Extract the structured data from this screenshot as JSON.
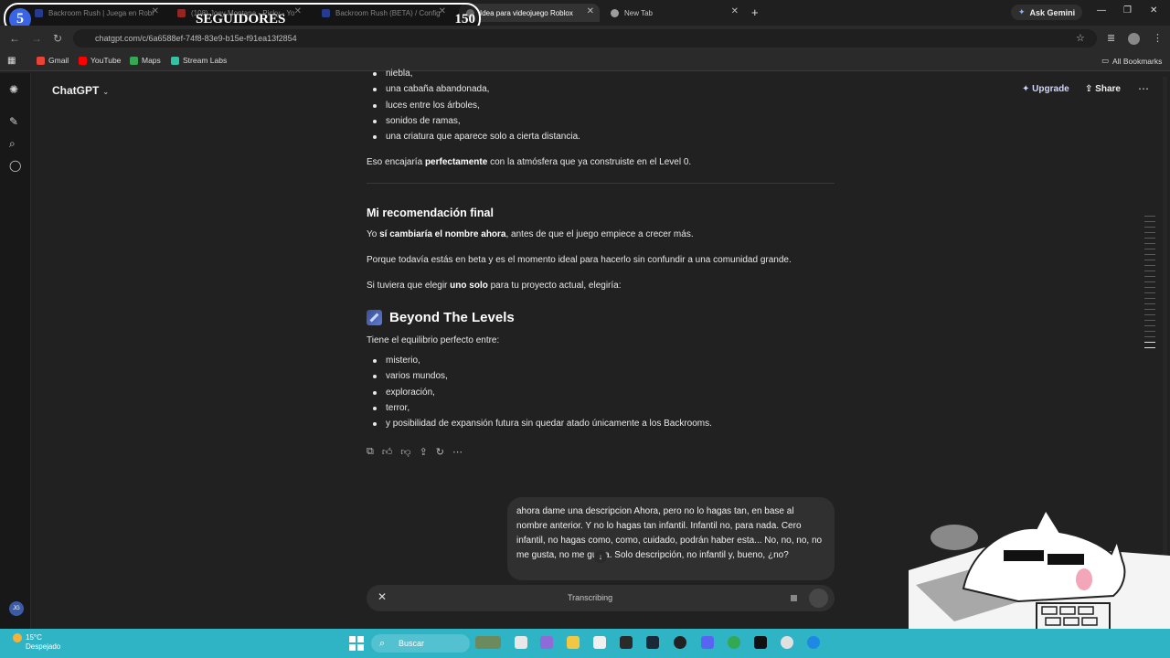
{
  "browser": {
    "tabs": [
      {
        "title": "Backroom Rush | Juega en Robl",
        "color": "#3b5bdb"
      },
      {
        "title": "(108) Joey Montana - Picky - Yo",
        "color": "#e53935"
      },
      {
        "title": "Backroom Rush (BETA) / Config",
        "color": "#3b5bdb"
      },
      {
        "title": "Idea para videojuego Roblox",
        "color": "#9e9e9e"
      },
      {
        "title": "New Tab",
        "color": "#9e9e9e"
      }
    ],
    "ask_gemini": "Ask Gemini",
    "url": "chatgpt.com/c/6a6588ef-74f8-83e9-b15e-f91ea13f2854",
    "bookmarks": [
      {
        "label": "Gmail",
        "color": "#ea4335"
      },
      {
        "label": "YouTube",
        "color": "#ff0000"
      },
      {
        "label": "Maps",
        "color": "#34a853"
      },
      {
        "label": "Stream Labs",
        "color": "#31c3a2"
      }
    ],
    "all_bookmarks": "All Bookmarks"
  },
  "stream_overlay": {
    "rank": "5",
    "label": "SEGUIDORES",
    "count": "150"
  },
  "app": {
    "title": "ChatGPT",
    "upgrade": "Upgrade",
    "share": "Share",
    "user_initials": "JG"
  },
  "message": {
    "list_top": [
      "niebla,",
      "una cabaña abandonada,",
      "luces entre los árboles,",
      "sonidos de ramas,",
      "una criatura que aparece solo a cierta distancia."
    ],
    "p1_pre": "Eso encajaría ",
    "p1_bold": "perfectamente",
    "p1_post": " con la atmósfera que ya construiste en el Level 0.",
    "heading_rec": "Mi recomendación final",
    "p2_pre": "Yo ",
    "p2_bold": "sí cambiaría el nombre ahora",
    "p2_post": ", antes de que el juego empiece a crecer más.",
    "p3": "Porque todavía estás en beta y es el momento ideal para hacerlo sin confundir a una comunidad grande.",
    "p4_pre": "Si tuviera que elegir ",
    "p4_bold": "uno solo",
    "p4_post": " para tu proyecto actual, elegiría:",
    "heading_name": "Beyond The Levels",
    "p5": "Tiene el equilibrio perfecto entre:",
    "list_bottom": [
      "misterio,",
      "varios mundos,",
      "exploración,",
      "terror,",
      "y posibilidad de expansión futura sin quedar atado únicamente a los Backrooms."
    ]
  },
  "user_bubble": {
    "text": "ahora dame una descripcion Ahora, pero no lo hagas tan, en base al nombre anterior. Y no lo hagas tan infantil. Infantil no, para nada. Cero infantil, no hagas como, como, cuidado, podrán haber esta... No, no, no, no me gusta, no me gusta. Solo descripción, no infantil y, bueno, ¿no?"
  },
  "composer": {
    "status": "Transcribing"
  },
  "taskbar": {
    "temp": "15°C",
    "condition": "Despejado",
    "search": "Buscar"
  }
}
